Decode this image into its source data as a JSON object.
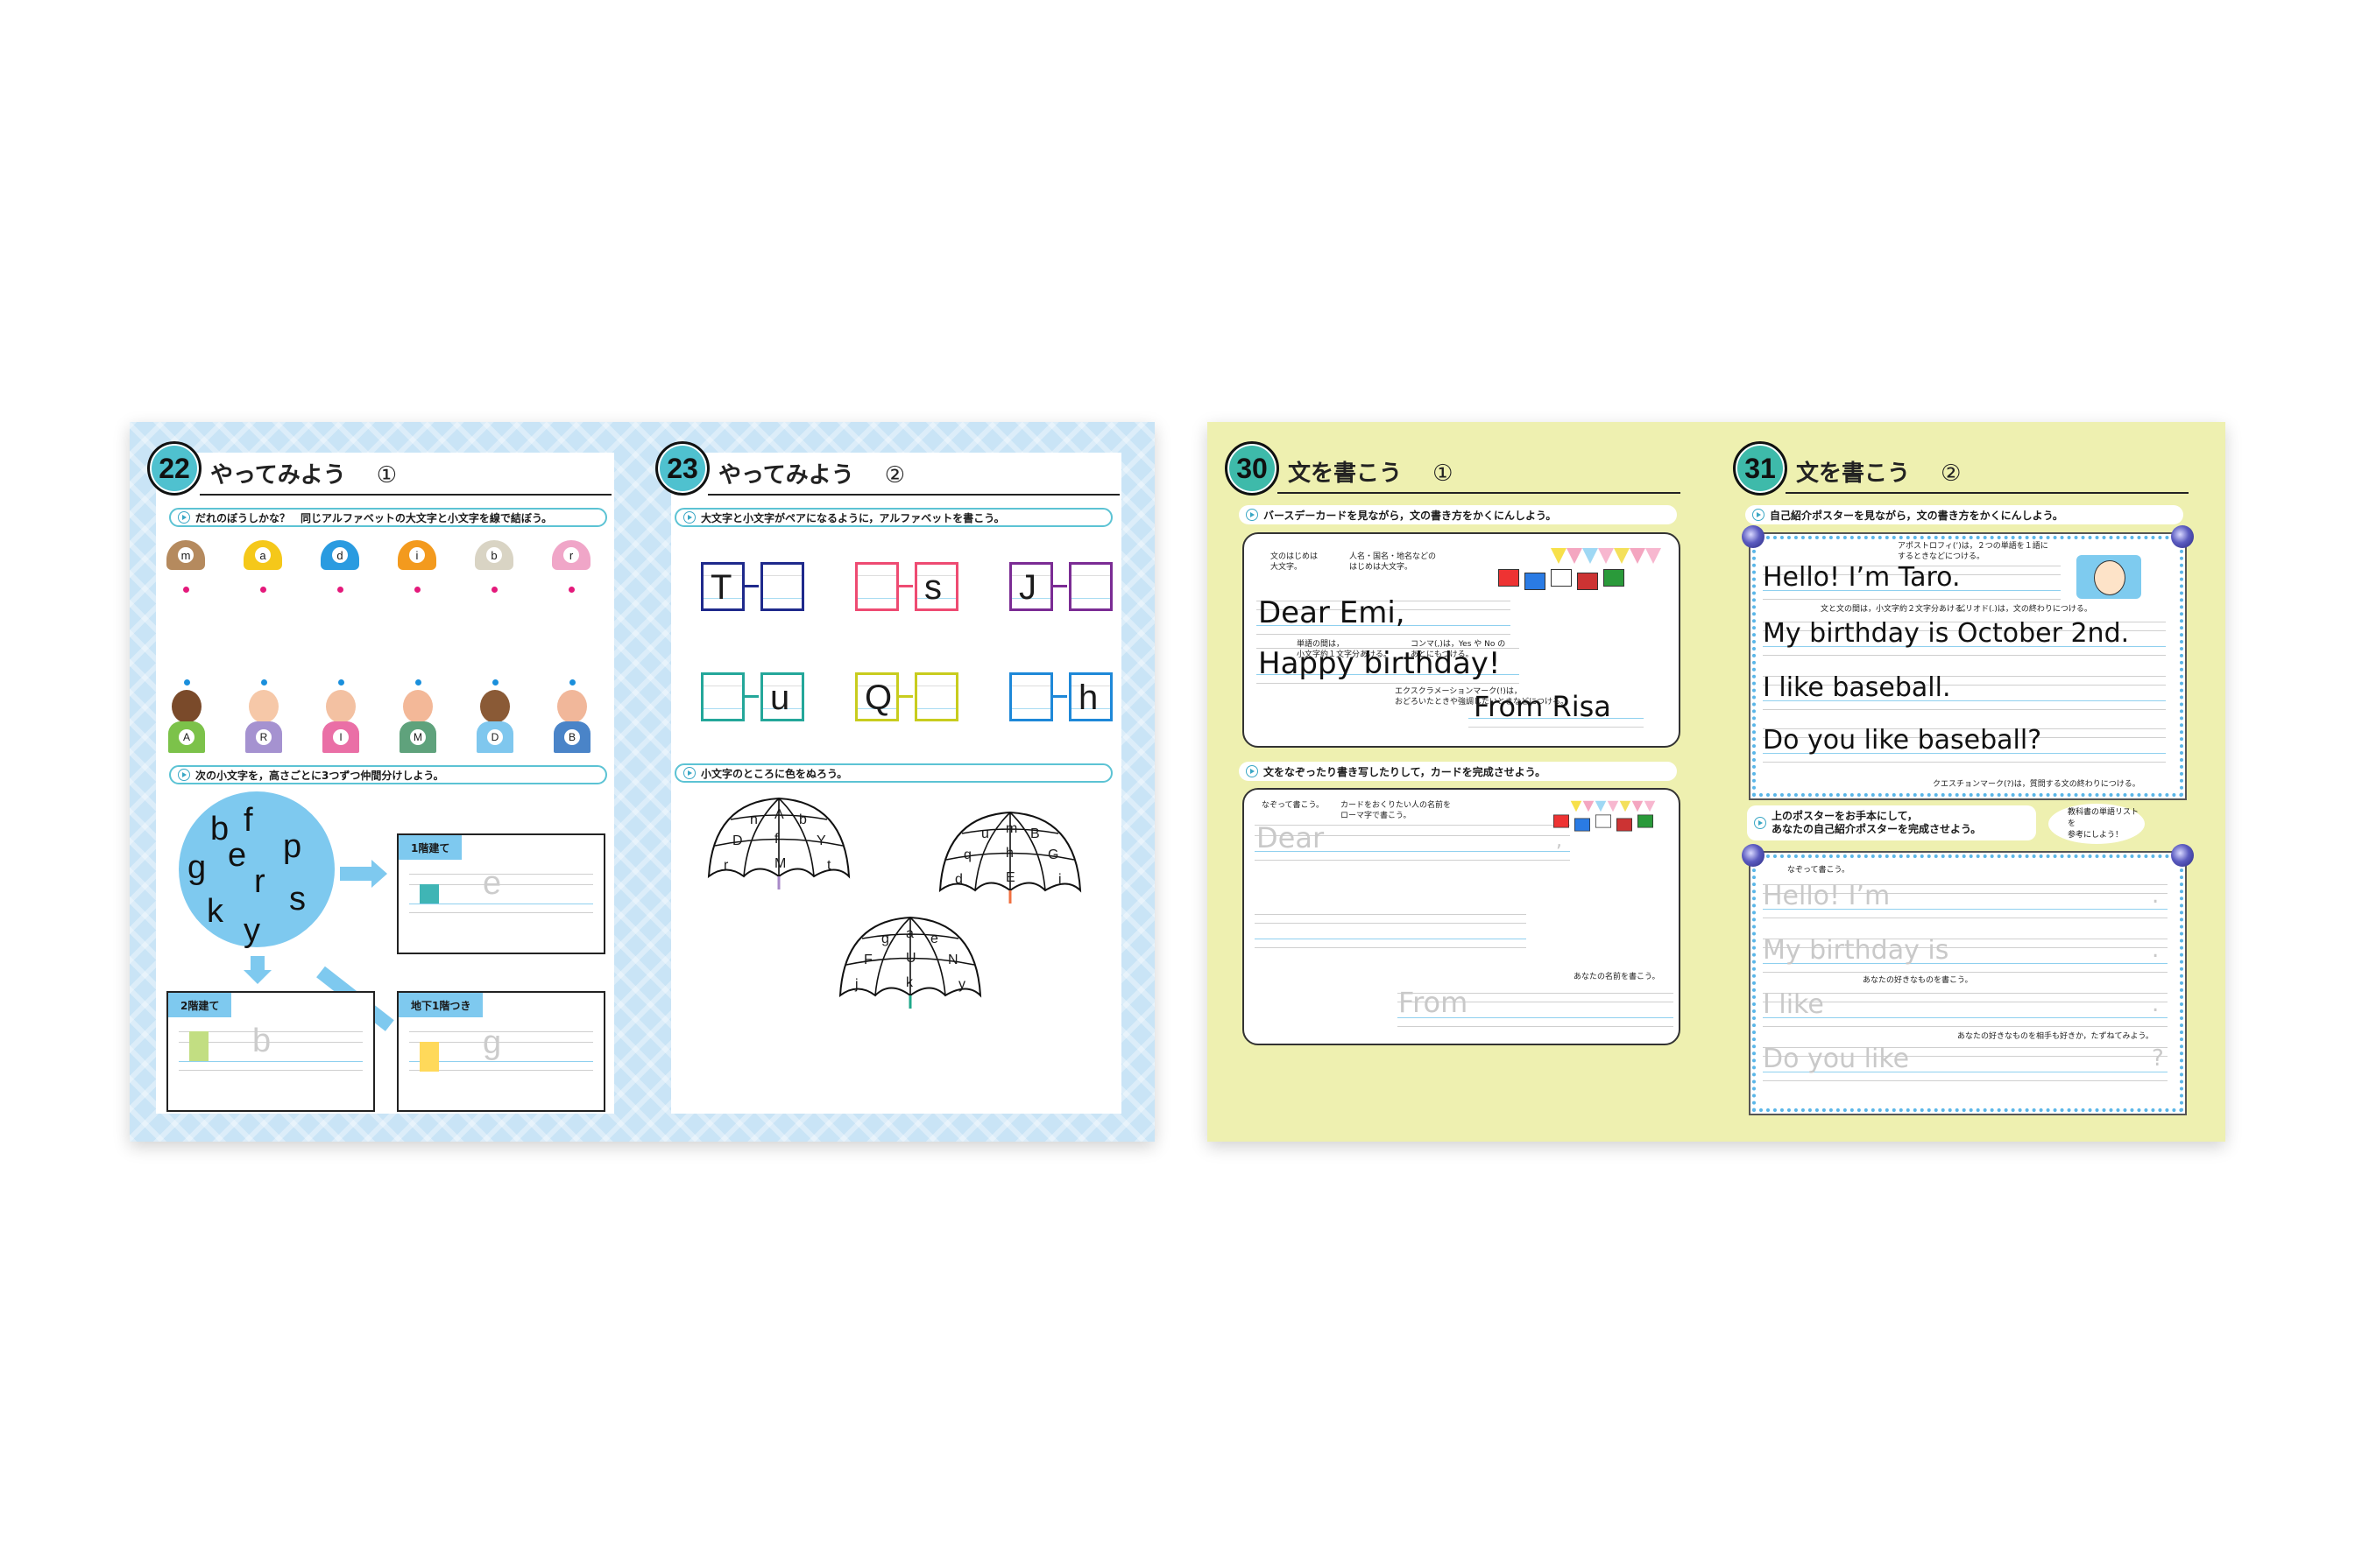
{
  "spreads": [
    {
      "theme": "blue",
      "background_color": "#c9e4f6",
      "pages": [
        {
          "number": "22",
          "title": "やってみよう",
          "subtitle_mark": "①",
          "sections": [
            {
              "instruction": "だれのぼうしかな？　同じアルファベットの大文字と小文字を線で結ぼう。",
              "hats": [
                {
                  "letter": "m",
                  "color": "#b58a5e"
                },
                {
                  "letter": "a",
                  "color": "#f5c81a"
                },
                {
                  "letter": "d",
                  "color": "#2a9be0"
                },
                {
                  "letter": "i",
                  "color": "#f39a1e"
                },
                {
                  "letter": "b",
                  "color": "#d9d4c4"
                },
                {
                  "letter": "r",
                  "color": "#f0a6c8"
                }
              ],
              "hat_dot_color": "#e4197b",
              "kids": [
                {
                  "letter": "A",
                  "shirt": "#7cc24a",
                  "skin": "#7a4a2a"
                },
                {
                  "letter": "R",
                  "shirt": "#a592d0",
                  "skin": "#f6c8a8"
                },
                {
                  "letter": "I",
                  "shirt": "#ea6fa6",
                  "skin": "#f3c1a2"
                },
                {
                  "letter": "M",
                  "shirt": "#5fa27c",
                  "skin": "#f3b898"
                },
                {
                  "letter": "D",
                  "shirt": "#7fc7ee",
                  "skin": "#8a5a36"
                },
                {
                  "letter": "B",
                  "shirt": "#4a84c8",
                  "skin": "#f1b79a"
                }
              ],
              "kid_dot_color": "#1a8fdc"
            },
            {
              "instruction": "次の小文字を，高さごとに3つずつ仲間分けしよう。",
              "letters": [
                "b",
                "f",
                "p",
                "e",
                "g",
                "r",
                "s",
                "k",
                "y"
              ],
              "groups": [
                {
                  "label": "1階建て",
                  "example": "e",
                  "swatch_color": "#3fb5b5",
                  "icon": "sprout-icon"
                },
                {
                  "label": "2階建て",
                  "example": "b",
                  "swatch_color": "#c2de82",
                  "icon": "sunflower-icon"
                },
                {
                  "label": "地下1階つき",
                  "example": "g",
                  "swatch_color": "#ffd95a",
                  "icon": "carrot-icon"
                }
              ]
            }
          ]
        },
        {
          "number": "23",
          "title": "やってみよう",
          "subtitle_mark": "②",
          "sections": [
            {
              "instruction": "大文字と小文字がペアになるように，アルファベットを書こう。",
              "pairs": [
                {
                  "upper": "T",
                  "lower": "",
                  "color": "#1f2a8c"
                },
                {
                  "upper": "",
                  "lower": "s",
                  "color": "#ee4b72"
                },
                {
                  "upper": "J",
                  "lower": "",
                  "color": "#7b2c94"
                },
                {
                  "upper": "",
                  "lower": "u",
                  "color": "#24a79a"
                },
                {
                  "upper": "Q",
                  "lower": "",
                  "color": "#c8cc1e"
                },
                {
                  "upper": "",
                  "lower": "h",
                  "color": "#1e88d8"
                }
              ]
            },
            {
              "instruction": "小文字のところに色をぬろう。",
              "umbrellas": [
                {
                  "letters": [
                    "n",
                    "A",
                    "b",
                    "D",
                    "f",
                    "Y",
                    "r",
                    "M",
                    "t"
                  ],
                  "handle_color": "#a889c8"
                },
                {
                  "letters": [
                    "g",
                    "a",
                    "e",
                    "F",
                    "U",
                    "N",
                    "j",
                    "k",
                    "y"
                  ],
                  "handle_color": "#20a88a"
                },
                {
                  "letters": [
                    "u",
                    "m",
                    "B",
                    "q",
                    "h",
                    "G",
                    "d",
                    "E",
                    "i"
                  ],
                  "handle_color": "#f07040"
                }
              ]
            }
          ]
        }
      ]
    },
    {
      "theme": "yellow",
      "background_color": "#eef0b0",
      "pages": [
        {
          "number": "30",
          "title": "文を書こう",
          "subtitle_mark": "①",
          "sections": [
            {
              "instruction": "バースデーカードを見ながら，文の書き方をかくにんしよう。",
              "card_lines": [
                "Dear Emi,",
                "Happy birthday!",
                "From Risa"
              ],
              "notes": [
                "文のはじめは\n大文字。",
                "人名・国名・地名などの\nはじめは大文字。",
                "単語の間は，\n小文字約１文字分あける。",
                "コンマ(,)は，Yes や No の\nあとにもつける。",
                "エクスクラメーションマーク(!)は，\nおどろいたときや強調したいときなどにつける。"
              ]
            },
            {
              "instruction": "文をなぞったり書き写したりして，カードを完成させよう。",
              "trace_lines": [
                "Dear",
                "From"
              ],
              "trace_end_mark": ",",
              "notes": [
                "なぞって書こう。",
                "カードをおくりたい人の名前を\nローマ字で書こう。",
                "あなたの名前を書こう。"
              ]
            }
          ]
        },
        {
          "number": "31",
          "title": "文を書こう",
          "subtitle_mark": "②",
          "sections": [
            {
              "instruction": "自己紹介ポスターを見ながら，文の書き方をかくにんしよう。",
              "poster_lines": [
                "Hello!  I’m Taro.",
                "My birthday is October 2nd.",
                "I like baseball.",
                "Do you like baseball?"
              ],
              "notes": [
                "アポストロフィ(’)は，２つの単語を１語に\nするときなどにつける。",
                "文と文の間は，小文字約２文字分あける。",
                "ピリオド(.)は，文の終わりにつける。",
                "クエスチョンマーク(?)は，質問する文の終わりにつける。"
              ]
            },
            {
              "instruction": "上のポスターをお手本にして，\nあなたの自己紹介ポスターを完成させよう。",
              "tip_bubble": "教科書の単語リストを\n参考にしよう！",
              "trace_lines": [
                "Hello!  I’m",
                "My birthday is",
                "I like",
                "Do you like"
              ],
              "trace_end_marks": [
                ".",
                ".",
                ".",
                "?"
              ],
              "notes": [
                "なぞって書こう。",
                "あなたの好きなものを書こう。",
                "あなたの好きなものを相手も好きか，たずねてみよう。"
              ]
            }
          ]
        }
      ]
    }
  ]
}
